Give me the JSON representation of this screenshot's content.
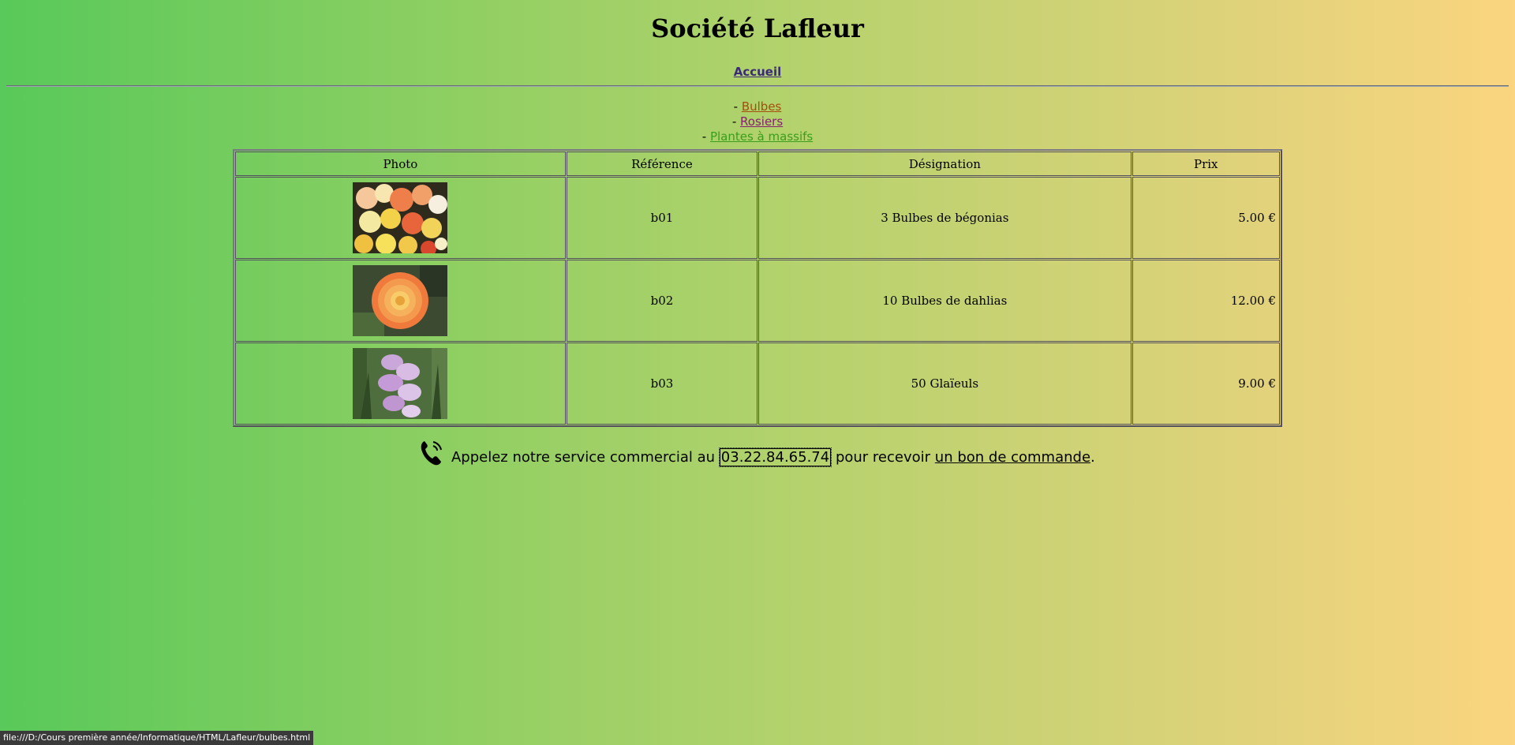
{
  "header": {
    "title": "Société Lafleur",
    "home_link": "Accueil"
  },
  "categories": [
    {
      "prefix": "- ",
      "label": "Bulbes",
      "color": "#a34f0c"
    },
    {
      "prefix": "- ",
      "label": "Rosiers",
      "color": "#8a1e73"
    },
    {
      "prefix": "- ",
      "label": "Plantes à massifs",
      "color": "#3a9e1c"
    }
  ],
  "table": {
    "headers": [
      "Photo",
      "Référence",
      "Désignation",
      "Prix"
    ],
    "rows": [
      {
        "photo_icon": "begonia-photo",
        "reference": "b01",
        "designation": "3 Bulbes de bégonias",
        "price": "5.00 €"
      },
      {
        "photo_icon": "dahlia-photo",
        "reference": "b02",
        "designation": "10 Bulbes de dahlias",
        "price": "12.00 €"
      },
      {
        "photo_icon": "gladiolus-photo",
        "reference": "b03",
        "designation": "50 Glaïeuls",
        "price": "9.00 €"
      }
    ]
  },
  "footer": {
    "icon": "phone-icon",
    "text_before": "Appelez notre service commercial au",
    "phone": "03.22.84.65.74",
    "text_middle": "pour recevoir",
    "order_link": "un bon de commande",
    "text_after": "."
  },
  "status_bar": {
    "url": "file:///D:/Cours première année/Informatique/HTML/Lafleur/bulbes.html"
  }
}
